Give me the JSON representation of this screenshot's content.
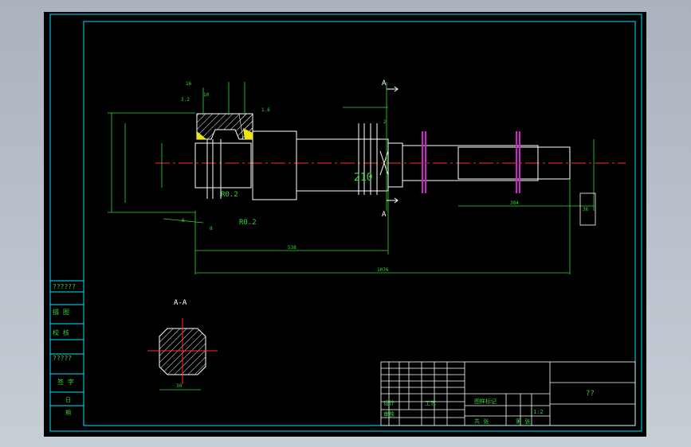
{
  "drawing": {
    "section_label_top": "A",
    "section_label_bottom": "A",
    "section_title": "A-A",
    "spline_label": "210",
    "fillet_upper": "R0.2",
    "fillet_lower": "R0.2",
    "roughness_a": "3.2",
    "roughness_b": "1.6",
    "dim_small_a": "16",
    "dim_small_b": "10",
    "dim_small_c": "6",
    "dim_small_d": "8",
    "dim_mid": "538",
    "dim_total": "1076",
    "dim_right_len": "384",
    "dim_section_width": "30",
    "side_note_box": "36",
    "note_c": "2"
  },
  "left_panel": {
    "row1": "??????",
    "row2": "描 图",
    "row3": "校 核",
    "row4": "?????",
    "row5": "签 字",
    "row6": "日",
    "row7": "期"
  },
  "title_block": {
    "drawing_name": "??",
    "sheet_label": "图样标记",
    "scale": "1:2",
    "design": "设计",
    "review": "审核",
    "process": "工艺",
    "sheet_count": "共  张",
    "sheet_number": "第  张"
  },
  "colors": {
    "viewport_bg": "#000000",
    "frame_cyan": "#00e5ff",
    "dimension_green": "#35d43a",
    "geometry_white": "#ffffff",
    "centerline_red": "#ff2a2a",
    "keyway_magenta": "#d024d0",
    "highlight_yellow": "#f2e600"
  }
}
